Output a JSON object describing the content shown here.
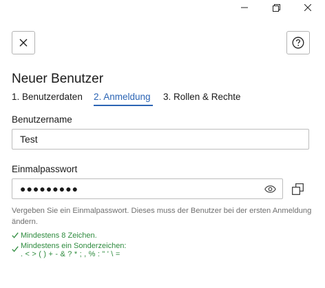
{
  "window": {
    "minimize_icon": "minimize-icon",
    "maximize_icon": "restore-icon",
    "close_icon": "close-icon"
  },
  "dialog": {
    "close_icon": "close-x-icon",
    "help_icon": "help-question-icon",
    "title": "Neuer Benutzer"
  },
  "steps": [
    {
      "label": "1. Benutzerdaten",
      "active": false
    },
    {
      "label": "2. Anmeldung",
      "active": true
    },
    {
      "label": "3. Rollen & Rechte",
      "active": false
    }
  ],
  "form": {
    "username_label": "Benutzername",
    "username_value": "Test",
    "password_label": "Einmalpasswort",
    "password_masked": "●●●●●●●●●",
    "show_password_icon": "eye-icon",
    "copy_icon": "copy-icon",
    "hint": "Vergeben Sie ein Einmalpasswort. Dieses muss der Benutzer bei der ersten Anmeldung ändern."
  },
  "rules": [
    {
      "text": "Mindestens 8 Zeichen."
    },
    {
      "text": "Mindestens ein Sonderzeichen:",
      "sub": ". < > ( ) + - & ? * ; , % : \" ' \\ ="
    }
  ],
  "colors": {
    "accent": "#2b64b4",
    "success": "#2e8b3e",
    "hint": "#6f6f6f",
    "border": "#bdbdbd"
  }
}
